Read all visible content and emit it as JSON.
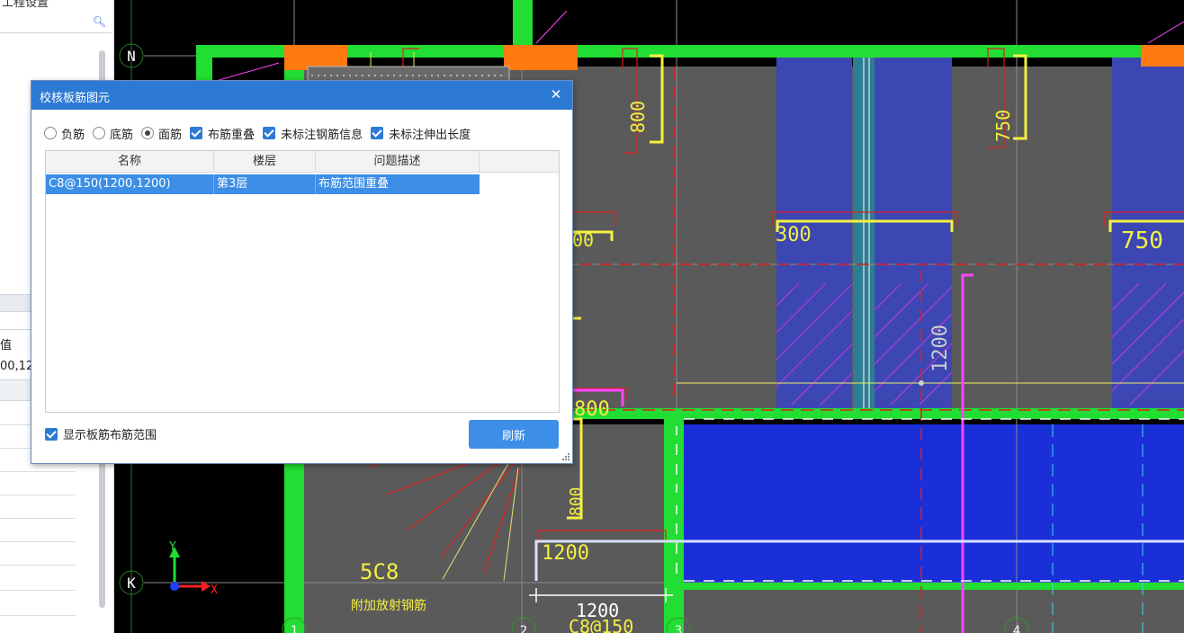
{
  "left_panel": {
    "partial_title": "工程设置",
    "search_placeholder": "",
    "property_column_header": "值",
    "property_value": "00,12"
  },
  "cad": {
    "dimension_labels": [
      "800",
      "750",
      "300",
      "750",
      "1200",
      "00",
      "800",
      "800",
      "1200",
      "1200",
      "5C8",
      "C8@150"
    ],
    "annotation_text": "附加放射钢筋",
    "axis_labels": [
      "N",
      "K",
      "1",
      "2",
      "3",
      "4"
    ],
    "ucs": {
      "x_label": "X",
      "y_label": "Y"
    }
  },
  "dialog": {
    "title": "校核板筋图元",
    "close_symbol": "✕",
    "options": [
      {
        "kind": "radio",
        "label": "负筋",
        "checked": false
      },
      {
        "kind": "radio",
        "label": "底筋",
        "checked": false
      },
      {
        "kind": "radio",
        "label": "面筋",
        "checked": true
      },
      {
        "kind": "checkbox",
        "label": "布筋重叠",
        "checked": true
      },
      {
        "kind": "checkbox",
        "label": "未标注钢筋信息",
        "checked": true
      },
      {
        "kind": "checkbox",
        "label": "未标注伸出长度",
        "checked": true
      }
    ],
    "table": {
      "columns": [
        "名称",
        "楼层",
        "问题描述"
      ],
      "rows": [
        {
          "name": "C8@150(1200,1200)",
          "floor": "第3层",
          "desc": "布筋范围重叠",
          "selected": true
        }
      ]
    },
    "show_range_label": "显示板筋布筋范围",
    "show_range_checked": true,
    "refresh_label": "刷新"
  },
  "colors": {
    "titlebar": "#2d7ad4",
    "selection": "#3c8ee6",
    "wall_green": "#22dd33",
    "slab_gray": "#5a5a5a",
    "rebar_region_blue": "#1a2fd8",
    "rebar_yellow": "#f5f040",
    "magenta": "#ff44ff"
  }
}
